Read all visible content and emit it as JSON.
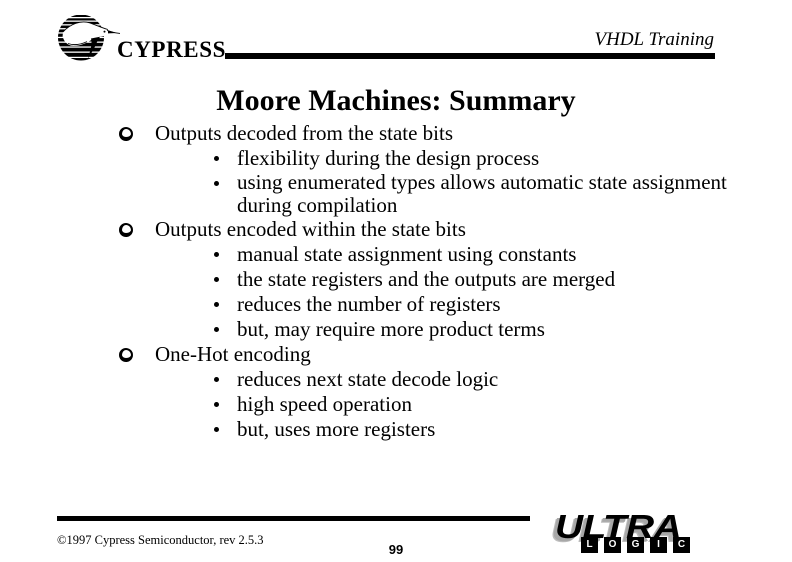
{
  "slide": {
    "header": {
      "brand_mark_icon": "cypress-semiconductor-circle-logo",
      "brand_wordmark": "CYPRESS",
      "course_title": "VHDL Training"
    },
    "title": "Moore Machines: Summary",
    "bullets": [
      {
        "level": 1,
        "bullet_glyph": "hollow-circle",
        "text": "Outputs decoded from the state bits",
        "children": [
          {
            "level": 2,
            "bullet_glyph": "round-dot",
            "text": "flexibility during the design process"
          },
          {
            "level": 2,
            "bullet_glyph": "round-dot",
            "text": "using enumerated types allows automatic state assignment during compilation"
          }
        ]
      },
      {
        "level": 1,
        "bullet_glyph": "hollow-circle",
        "text": "Outputs encoded within the state bits",
        "children": [
          {
            "level": 2,
            "bullet_glyph": "round-dot",
            "text": "manual state assignment using constants"
          },
          {
            "level": 2,
            "bullet_glyph": "round-dot",
            "text": "the state registers and the outputs are merged"
          },
          {
            "level": 2,
            "bullet_glyph": "round-dot",
            "text": "reduces the number of registers"
          },
          {
            "level": 2,
            "bullet_glyph": "round-dot",
            "text": "but, may require more product terms"
          }
        ]
      },
      {
        "level": 1,
        "bullet_glyph": "hollow-circle",
        "text": "One-Hot encoding",
        "children": [
          {
            "level": 2,
            "bullet_glyph": "round-dot",
            "text": "reduces next state decode logic"
          },
          {
            "level": 2,
            "bullet_glyph": "round-dot",
            "text": "high speed operation"
          },
          {
            "level": 2,
            "bullet_glyph": "round-dot",
            "text": "but, uses more registers"
          }
        ]
      }
    ],
    "footer": {
      "copyright": "©1997 Cypress Semiconductor, rev 2.5.3",
      "page_number": "99",
      "product_logo": {
        "primary_word": "ULTRA",
        "secondary_letters": [
          "L",
          "O",
          "G",
          "I",
          "C"
        ]
      }
    },
    "colors": {
      "background": "#ffffff",
      "text": "#000000",
      "rule": "#000000",
      "logo_shadow": "#a8a8a8"
    }
  }
}
